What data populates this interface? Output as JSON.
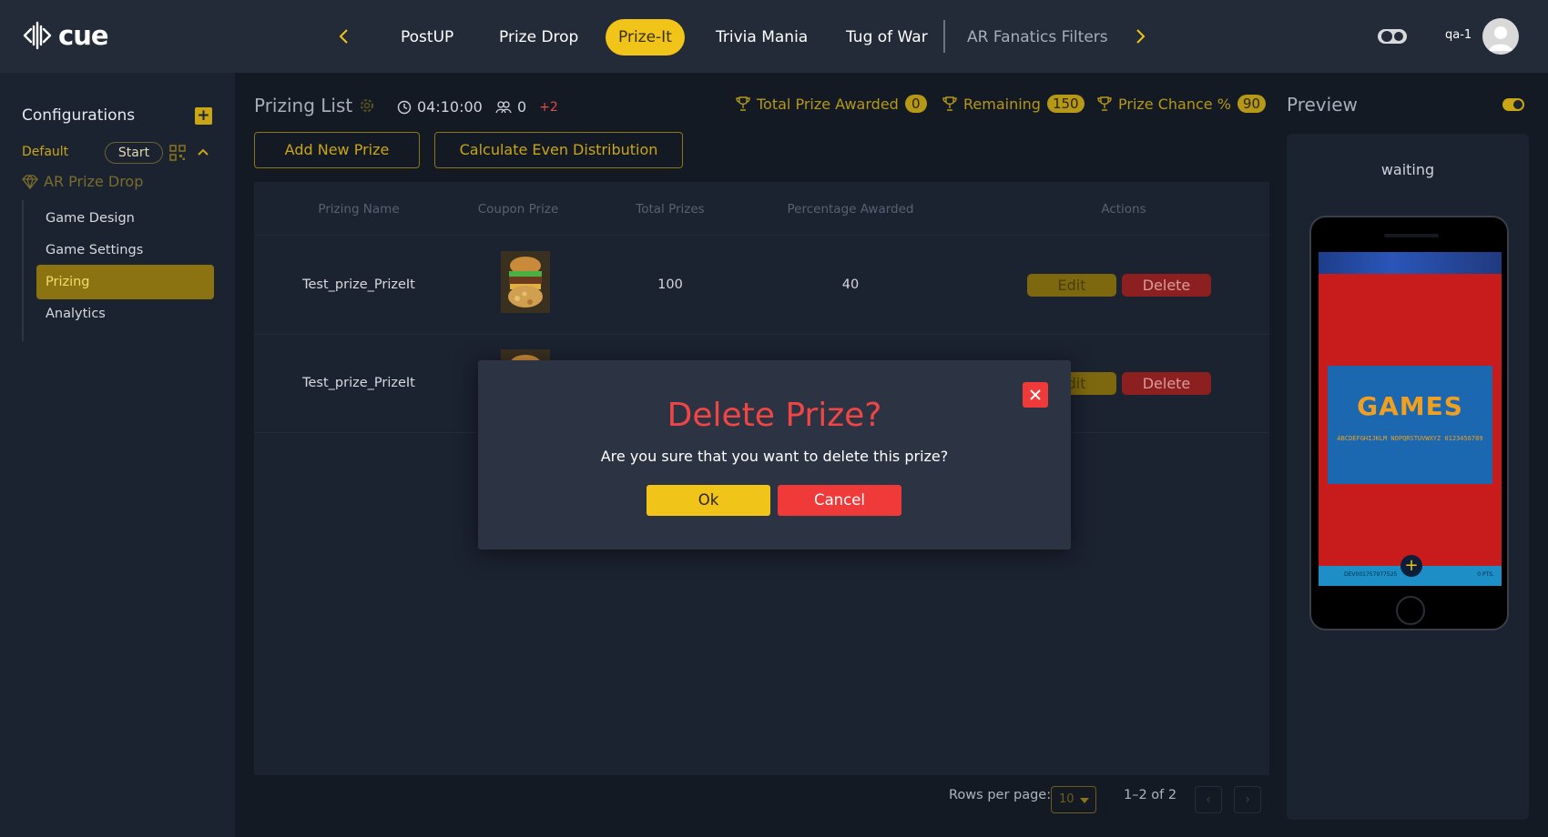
{
  "app": {
    "logo_text": "cue"
  },
  "topnav": {
    "tabs": [
      {
        "label": "PostUP"
      },
      {
        "label": "Prize Drop"
      },
      {
        "label": "Prize-It"
      },
      {
        "label": "Trivia Mania"
      },
      {
        "label": "Tug of War"
      },
      {
        "label": "AR Fanatics Filters"
      }
    ],
    "active_tab": "Prize-It",
    "user_label": "qa-1"
  },
  "sidebar": {
    "title": "Configurations",
    "config_name": "Default",
    "start_label": "Start",
    "game_name": "AR Prize Drop",
    "items": [
      {
        "label": "Game Design"
      },
      {
        "label": "Game Settings"
      },
      {
        "label": "Prizing"
      },
      {
        "label": "Analytics"
      }
    ],
    "active_item": "Prizing"
  },
  "main": {
    "title": "Prizing List",
    "timer": "04:10:00",
    "players": "0",
    "players_delta": "+2",
    "stats": {
      "total_awarded_label": "Total Prize Awarded",
      "total_awarded_value": "0",
      "remaining_label": "Remaining",
      "remaining_value": "150",
      "chance_label": "Prize Chance %",
      "chance_value": "90"
    },
    "add_button": "Add New Prize",
    "calc_button": "Calculate Even Distribution"
  },
  "table": {
    "columns": [
      "Prizing Name",
      "Coupon Prize",
      "Total Prizes",
      "Percentage Awarded",
      "Actions"
    ],
    "rows": [
      {
        "name": "Test_prize_PrizeIt",
        "total": "100",
        "percent": "40",
        "edit": "Edit",
        "delete": "Delete"
      },
      {
        "name": "Test_prize_PrizeIt",
        "total": "",
        "percent": "",
        "edit": "Edit",
        "delete": "Delete"
      }
    ],
    "rows_per_page_label": "Rows per page:",
    "rows_per_page": "10",
    "range": "1–2 of 2"
  },
  "preview": {
    "title": "Preview",
    "status": "waiting",
    "card_title": "GAMES",
    "card_sub": "ABCDEFGHIJKLM NOPQRSTUVWXYZ 0123456789",
    "bar_text": "DEV001757977525",
    "bar_pts": "0 PTS."
  },
  "modal": {
    "title": "Delete Prize?",
    "message": "Are you sure that you want to delete this prize?",
    "ok": "Ok",
    "cancel": "Cancel"
  },
  "colors": {
    "accent": "#f0c419",
    "danger": "#f03a3a",
    "bg": "#141a24",
    "panel": "#1b2230",
    "topbar": "#232b38"
  }
}
